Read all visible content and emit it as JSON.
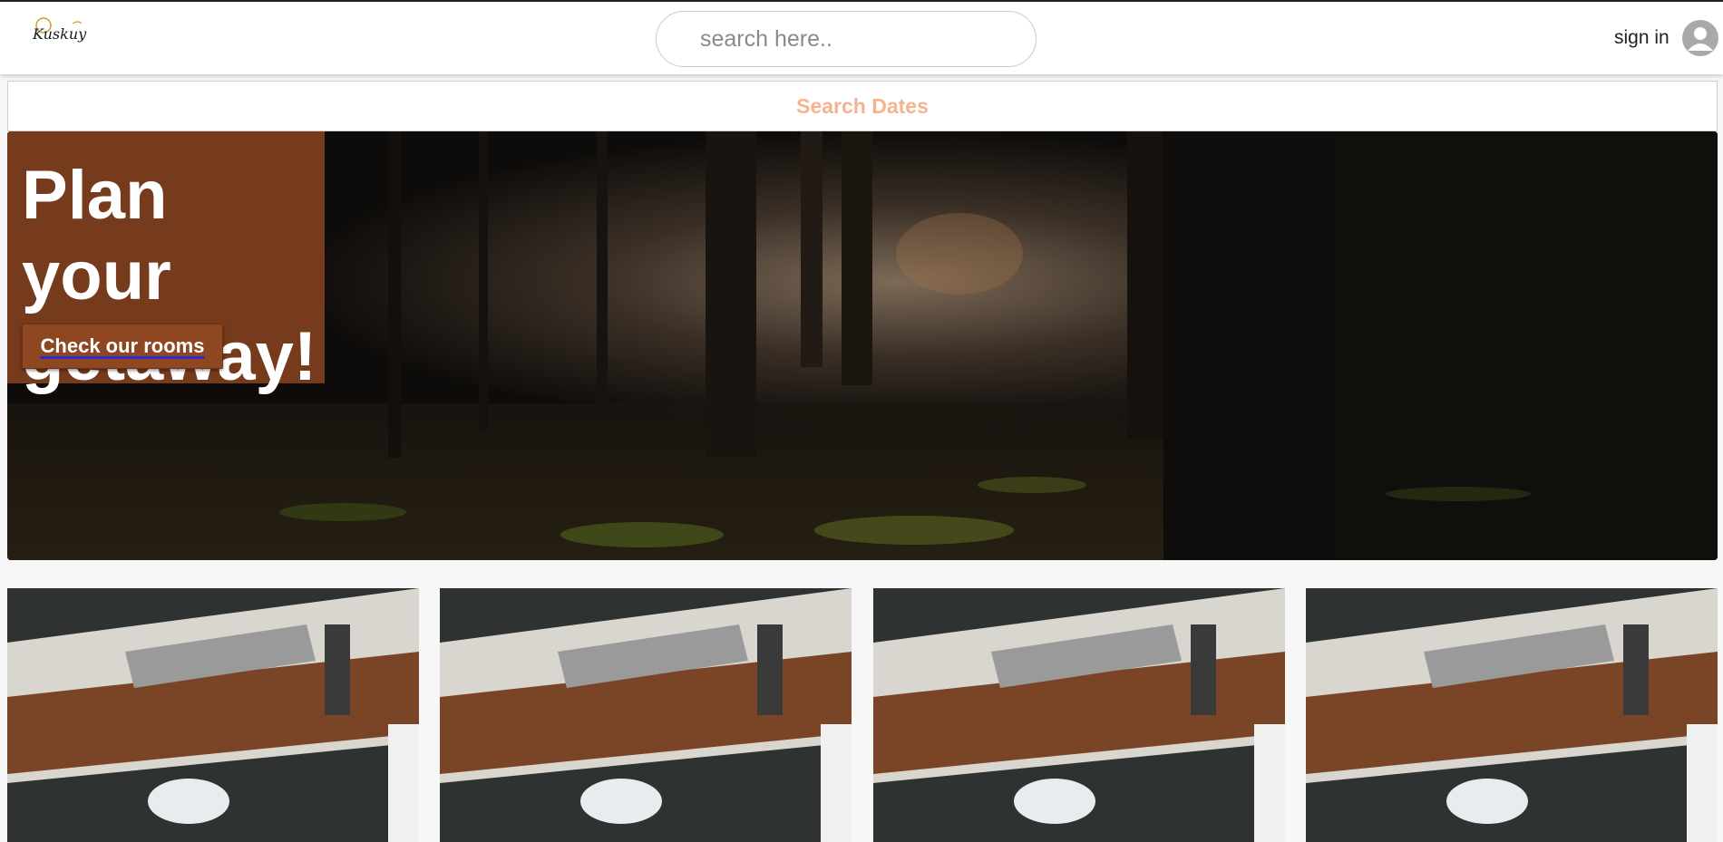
{
  "header": {
    "logo_text": "Kuskuy",
    "logo_icon": "logo-icon",
    "search_placeholder": "search here..",
    "signin_label": "sign in",
    "avatar_icon": "user-avatar-icon"
  },
  "dates_bar": {
    "label": "Search Dates",
    "color": "#f5b38f"
  },
  "hero": {
    "title": "Plan your getaway!",
    "button_label": "Check our rooms",
    "panel_color": "#763a1c",
    "button_color": "#8f4721"
  },
  "cards": [
    {
      "image": "kitchen-counter-photo"
    },
    {
      "image": "kitchen-counter-photo"
    },
    {
      "image": "kitchen-counter-photo"
    },
    {
      "image": "kitchen-counter-photo"
    }
  ]
}
